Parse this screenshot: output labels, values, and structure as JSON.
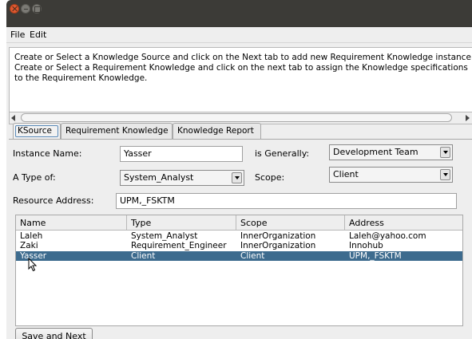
{
  "menu": {
    "file": "File",
    "edit": "Edit"
  },
  "instructions": [
    "Create or Select a Knowledge Source and click on the Next tab to add new Requirement Knowledge instance",
    "Create or Select a Requirement Knowledge and click on the next tab to assign the Knowledge specifications",
    "to the Requirement Knowledge."
  ],
  "tabs": [
    {
      "label": "KSource",
      "selected": true
    },
    {
      "label": "Requirement Knowledge",
      "selected": false
    },
    {
      "label": "Knowledge Report",
      "selected": false
    }
  ],
  "form": {
    "instance_name_label": "Instance Name:",
    "instance_name_value": "Yasser",
    "is_generally_label": "is Generally:",
    "is_generally_value": "Development Team",
    "type_of_label": "A Type of:",
    "type_of_value": "System_Analyst",
    "scope_label": "Scope:",
    "scope_value": "Client",
    "resource_address_label": "Resource Address:",
    "resource_address_value": "UPM,_FSKTM"
  },
  "table": {
    "columns": [
      "Name",
      "Type",
      "Scope",
      "Address"
    ],
    "rows": [
      {
        "name": "Laleh",
        "type": "System_Analyst",
        "scope": "InnerOrganization",
        "address": "Laleh@yahoo.com",
        "selected": false
      },
      {
        "name": "Zaki",
        "type": "Requirement_Engineer",
        "scope": "InnerOrganization",
        "address": "Innohub",
        "selected": false
      },
      {
        "name": "Yasser",
        "type": "Client",
        "scope": "Client",
        "address": "UPM,_FSKTM",
        "selected": true
      }
    ]
  },
  "buttons": {
    "save_next": "Save and Next"
  },
  "colors": {
    "selection": "#3d6b8e",
    "title_bar": "#3c3b37",
    "close_button": "#e0582f",
    "focus_ring": "#5a8ab8"
  },
  "icons": [
    "close-icon",
    "minimize-icon",
    "maximize-icon",
    "scroll-left-arrow-icon",
    "scroll-right-arrow-icon",
    "dropdown-arrow-icon",
    "mouse-pointer-icon"
  ]
}
